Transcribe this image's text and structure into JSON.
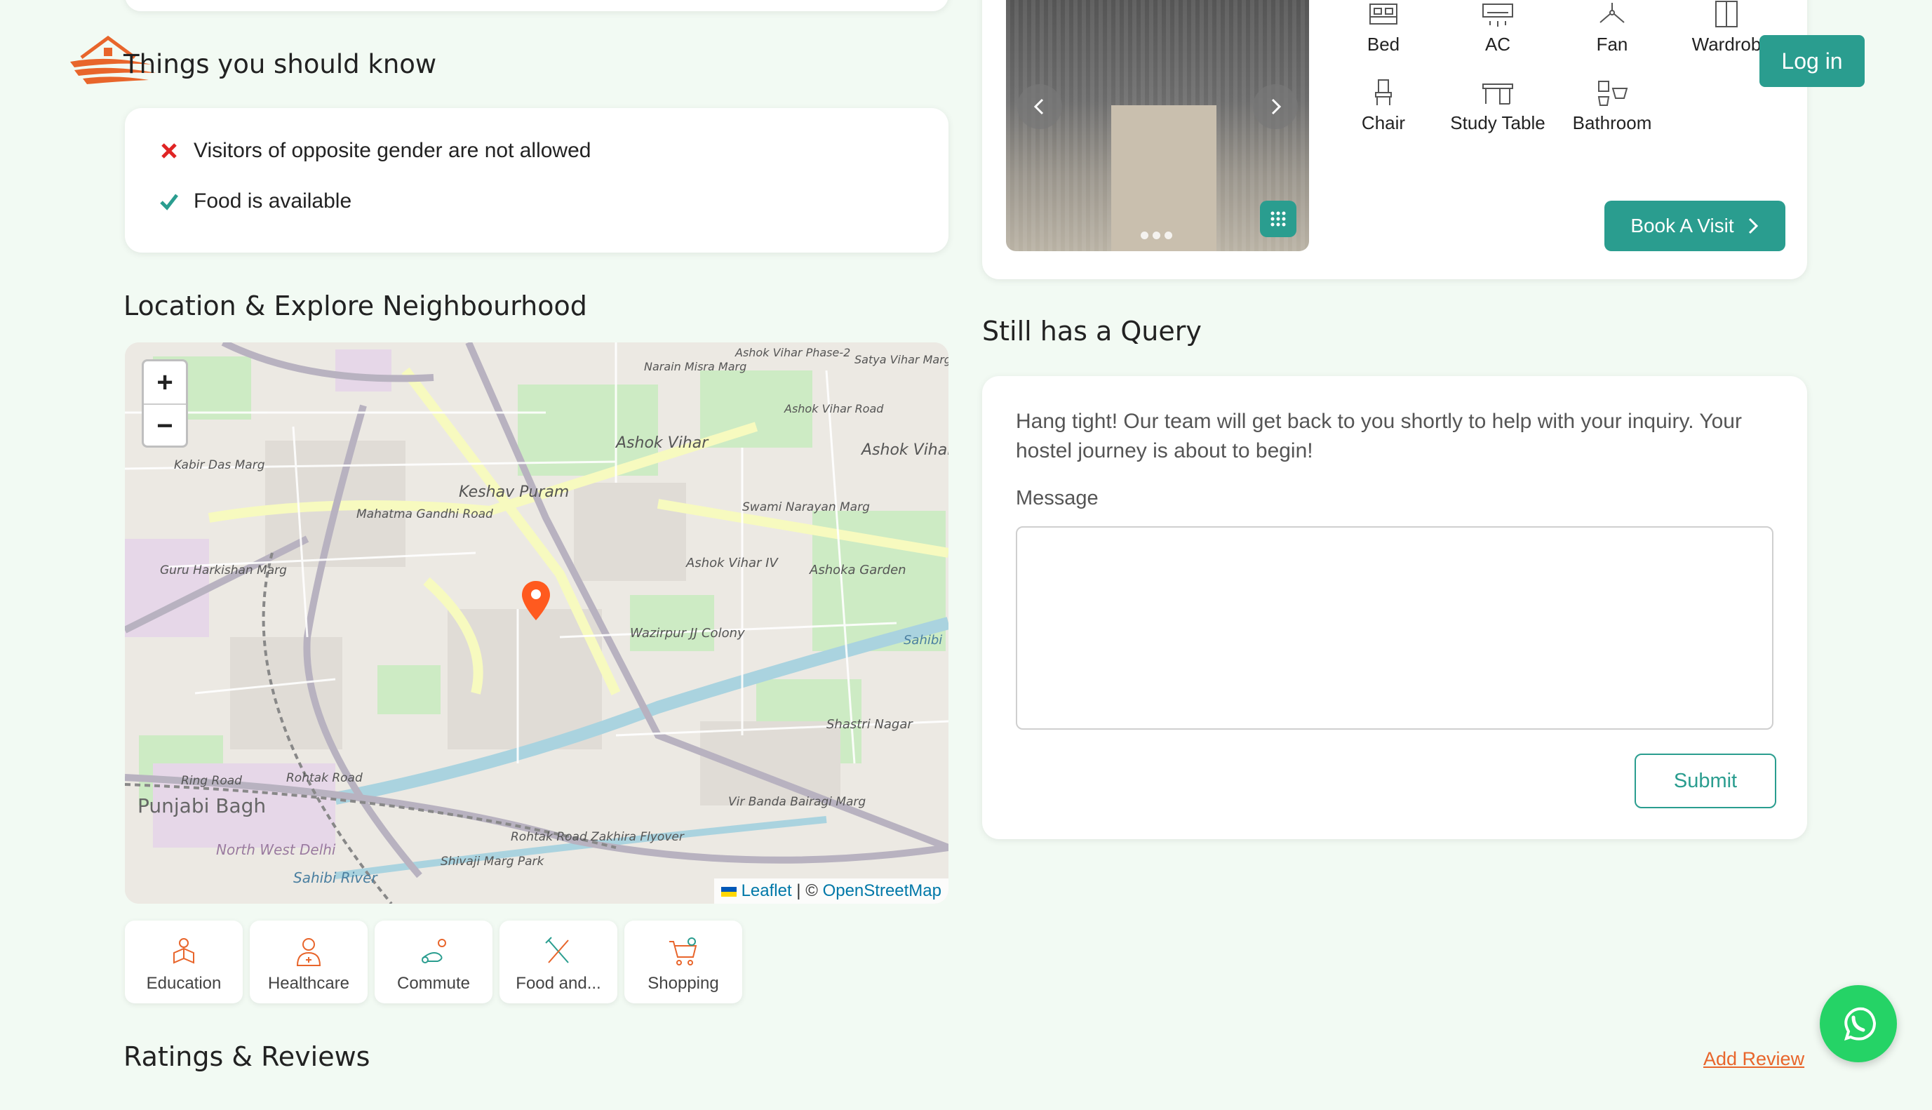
{
  "things": {
    "title": "Things you should know",
    "rules": [
      {
        "text": "Visitors of opposite gender are not allowed",
        "allowed": false
      },
      {
        "text": "Food is available",
        "allowed": true
      }
    ]
  },
  "location": {
    "title": "Location & Explore Neighbourhood",
    "zoom_in": "+",
    "zoom_out": "−",
    "attribution": {
      "leaflet": "Leaflet",
      "sep": " | © ",
      "osm": "OpenStreetMap"
    },
    "map_labels": [
      "Ashok Vihar",
      "Ashok Vihar - III",
      "Keshav Puram",
      "Kabir Das Marg",
      "Guru Harkishan Marg",
      "Mahatma Gandhi Road",
      "Swami Narayan Marg",
      "Ashok Vihar IV",
      "Ashoka Garden",
      "Wazirpur JJ Colony",
      "Sahibi",
      "Ring Road",
      "Rohtak Road",
      "Punjabi Bagh",
      "North West Delhi",
      "Sahibi River",
      "Shivaji Marg Park",
      "Rohtak Road Zakhira Flyover",
      "Vir Banda Bairagi Marg",
      "Shastri Nagar",
      "Ashok Vihar Phase-2",
      "Narain Misra Marg",
      "Ashok Vihar Road",
      "Satya Vihar Marg"
    ],
    "categories": [
      "Education",
      "Healthcare",
      "Commute",
      "Food and...",
      "Shopping"
    ]
  },
  "ratings": {
    "title": "Ratings & Reviews",
    "add_review": "Add Review"
  },
  "room": {
    "amenities": [
      "Bed",
      "AC",
      "Fan",
      "Wardrob",
      "Chair",
      "Study Table",
      "Bathroom"
    ],
    "book_visit": "Book A Visit"
  },
  "header": {
    "login": "Log in"
  },
  "query": {
    "title": "Still has a Query",
    "text": "Hang tight! Our team will get back to you shortly to help with your inquiry. Your hostel journey is about to begin!",
    "message_label": "Message",
    "message_value": "",
    "submit": "Submit"
  },
  "colors": {
    "accent": "#2a9d8f",
    "orange": "#e8652b",
    "whatsapp": "#25d366",
    "background": "#f2faf3"
  }
}
